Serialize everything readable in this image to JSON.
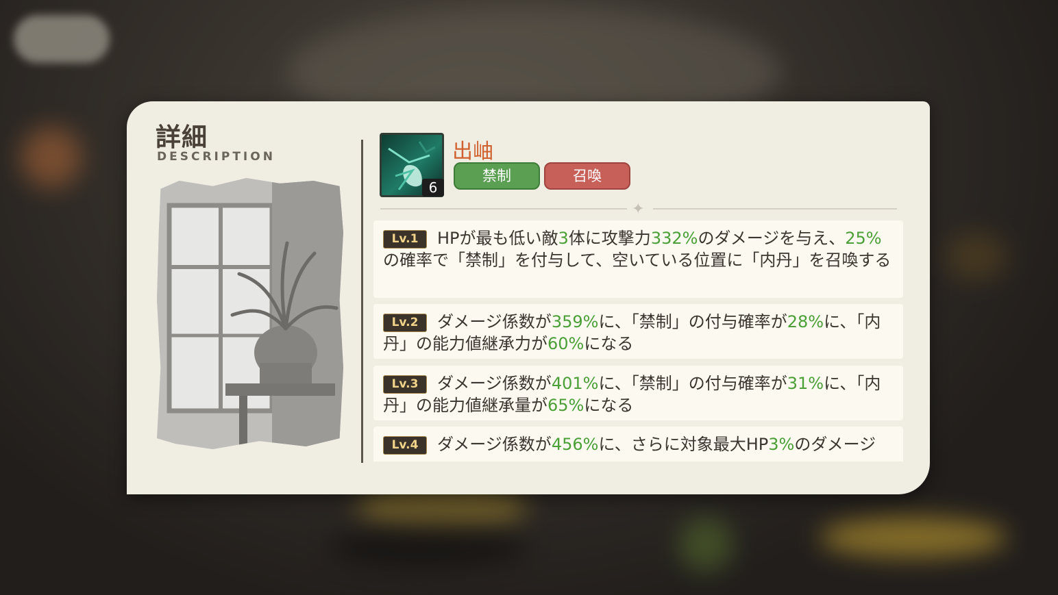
{
  "dialog": {
    "title": "詳細",
    "subtitle": "DESCRIPTION"
  },
  "skill": {
    "name": "出岫",
    "level": "6",
    "tags": [
      "禁制",
      "召喚"
    ],
    "icon": "spirit-skill-icon"
  },
  "levels": [
    {
      "badge": "Lv.1",
      "segments": [
        {
          "t": "HPが最も低い敵",
          "h": false
        },
        {
          "t": "3",
          "h": true
        },
        {
          "t": "体に攻撃力",
          "h": false
        },
        {
          "t": "332%",
          "h": true
        },
        {
          "t": "のダメージを与え、",
          "h": false
        },
        {
          "t": "25%",
          "h": true
        },
        {
          "t": "の確率で「禁制」を付与して、空いている位置に「内丹」を召喚する",
          "h": false
        }
      ]
    },
    {
      "badge": "Lv.2",
      "segments": [
        {
          "t": "ダメージ係数が",
          "h": false
        },
        {
          "t": "359%",
          "h": true
        },
        {
          "t": "に、「禁制」の付与確率が",
          "h": false
        },
        {
          "t": "28%",
          "h": true
        },
        {
          "t": "に、「内丹」の能力値継承力が",
          "h": false
        },
        {
          "t": "60%",
          "h": true
        },
        {
          "t": "になる",
          "h": false
        }
      ]
    },
    {
      "badge": "Lv.3",
      "segments": [
        {
          "t": "ダメージ係数が",
          "h": false
        },
        {
          "t": "401%",
          "h": true
        },
        {
          "t": "に、「禁制」の付与確率が",
          "h": false
        },
        {
          "t": "31%",
          "h": true
        },
        {
          "t": "に、「内丹」の能力値継承量が",
          "h": false
        },
        {
          "t": "65%",
          "h": true
        },
        {
          "t": "になる",
          "h": false
        }
      ]
    },
    {
      "badge": "Lv.4",
      "segments": [
        {
          "t": "ダメージ係数が",
          "h": false
        },
        {
          "t": "456%",
          "h": true
        },
        {
          "t": "に、さらに対象最大HP",
          "h": false
        },
        {
          "t": "3%",
          "h": true
        },
        {
          "t": "のダメージ",
          "h": false
        }
      ]
    }
  ],
  "colors": {
    "highlight": "#4aa036",
    "skill_name": "#d0612f",
    "tag_green": "#5a9f52",
    "tag_red": "#c8605a",
    "panel": "#f0ede3"
  }
}
